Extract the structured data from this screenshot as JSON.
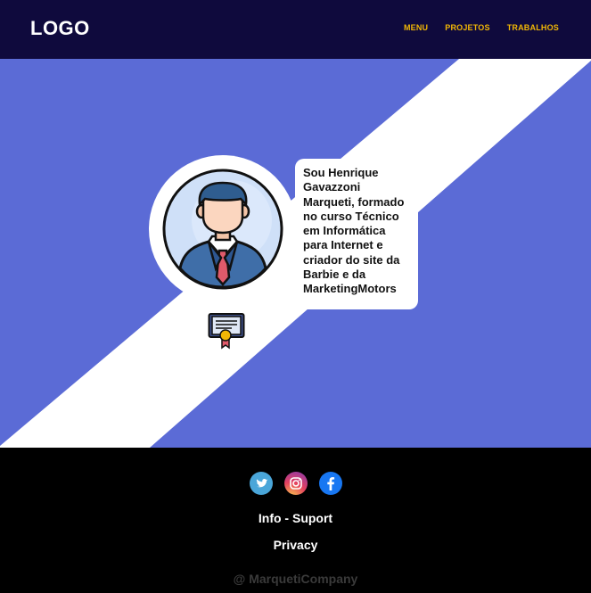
{
  "header": {
    "logo": "LOGO",
    "nav": [
      "MENU",
      "PROJETOS",
      "TRABALHOS"
    ]
  },
  "hero": {
    "bio": "Sou Henrique Gavazzoni Marqueti, formado no curso Técnico em Informática para Internet e criador do site da Barbie e da MarketingMotors"
  },
  "footer": {
    "social": [
      "twitter-icon",
      "instagram-icon",
      "facebook-icon"
    ],
    "info": "Info - Suport",
    "privacy": "Privacy",
    "company": "@ MarquetiCompany"
  },
  "colors": {
    "header_bg": "#0f0a3d",
    "nav_text": "#f2b705",
    "hero_bg": "#5b6bd6",
    "footer_bg": "#000000"
  }
}
